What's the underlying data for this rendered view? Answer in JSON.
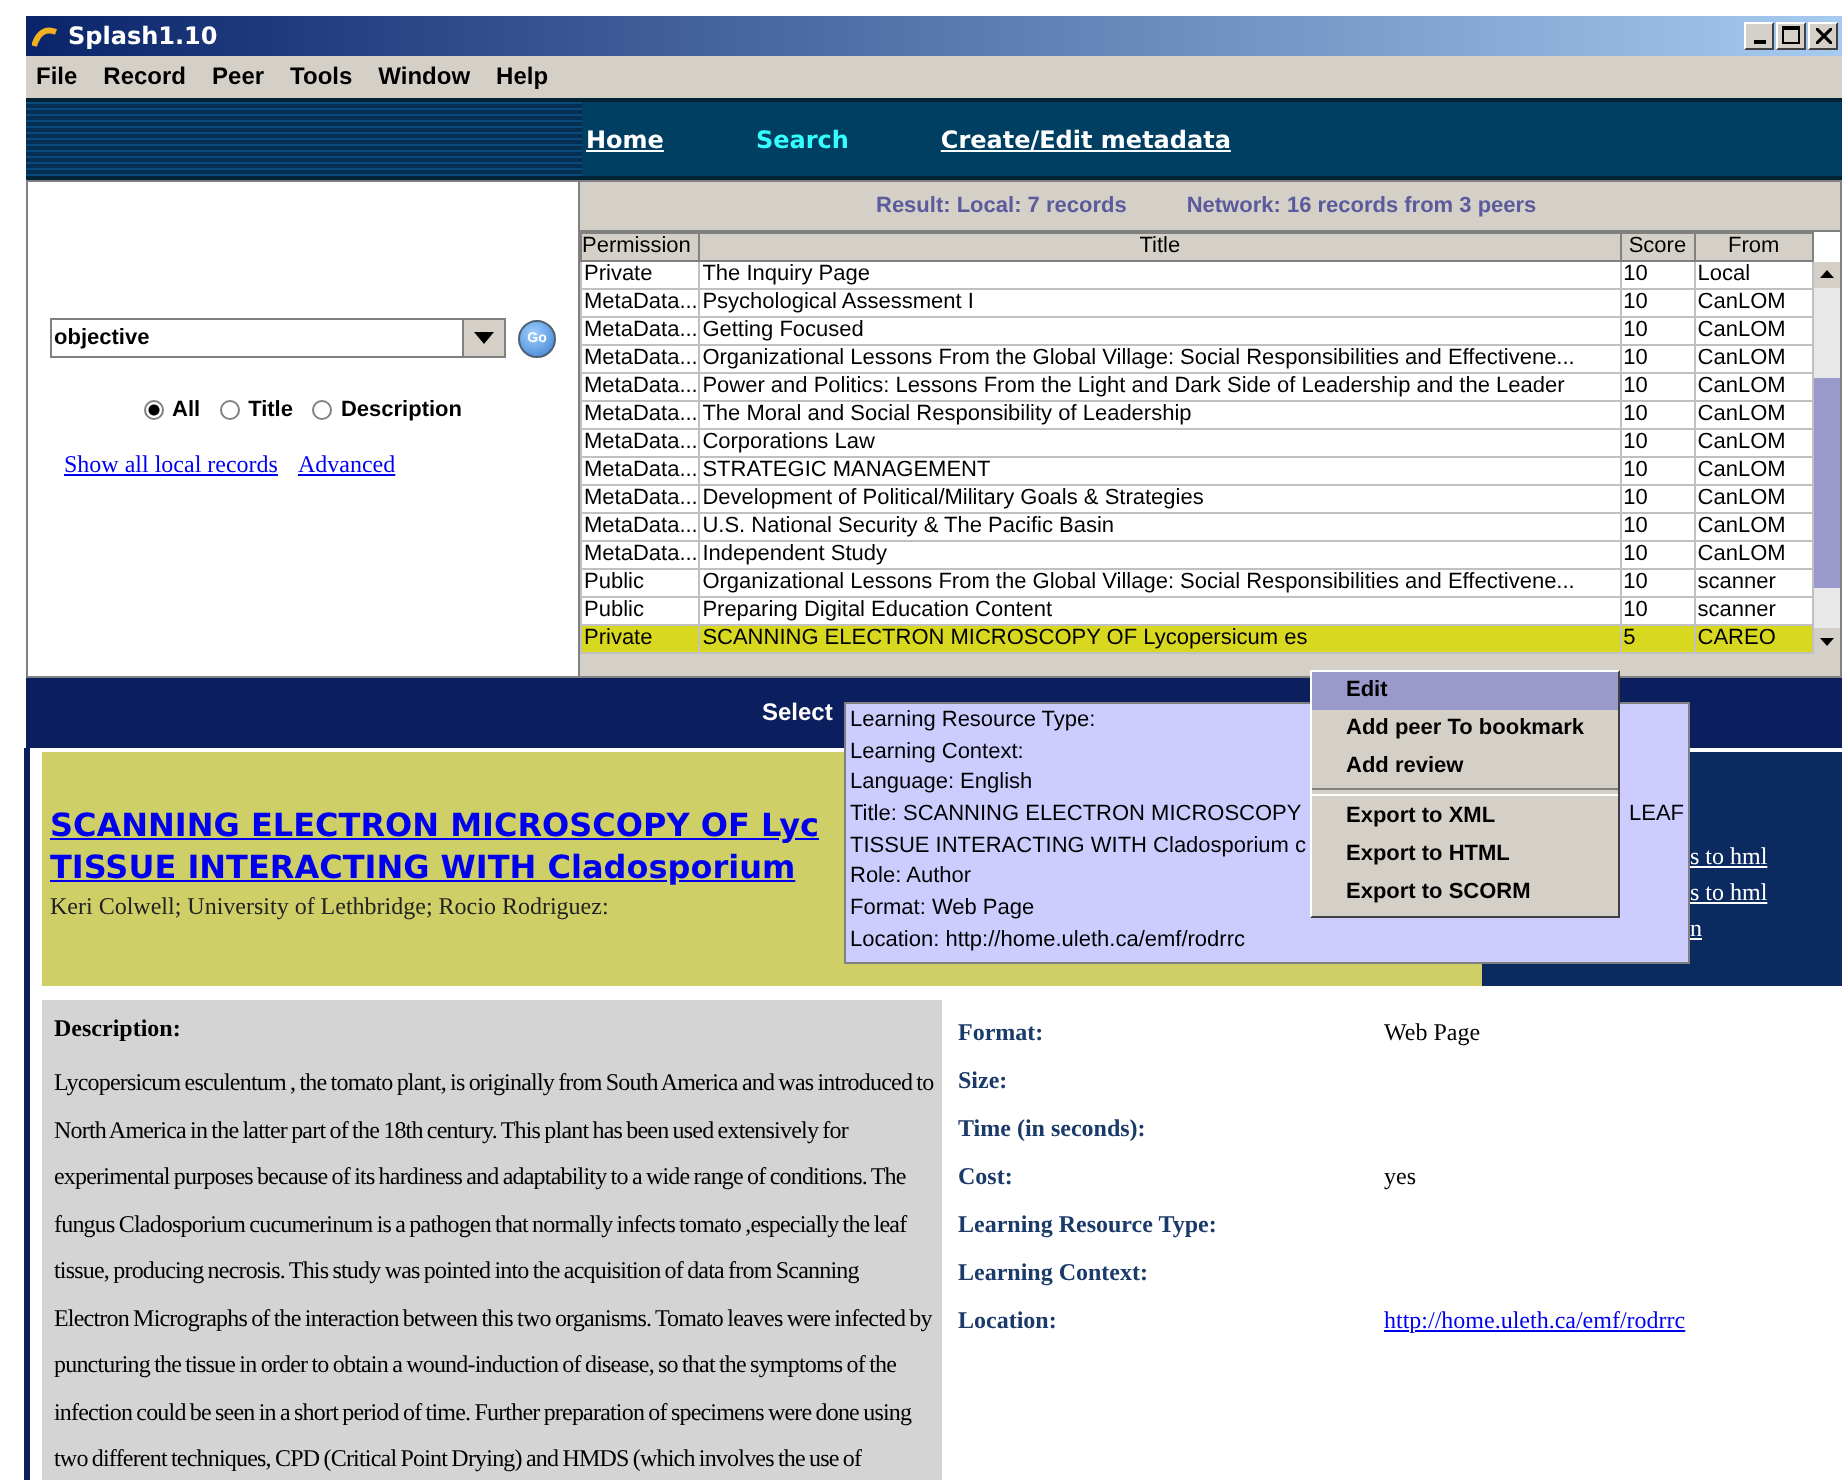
{
  "window": {
    "title": "Splash1.10"
  },
  "menu_bar": [
    "File",
    "Record",
    "Peer",
    "Tools",
    "Window",
    "Help"
  ],
  "nav": [
    {
      "label": "Home",
      "selected": false
    },
    {
      "label": "Search",
      "selected": true
    },
    {
      "label": "Create/Edit metadata",
      "selected": false
    }
  ],
  "search": {
    "value": "objective",
    "go_label": "Go",
    "scope": [
      {
        "label": "All",
        "selected": true
      },
      {
        "label": "Title",
        "selected": false
      },
      {
        "label": "Description",
        "selected": false
      }
    ],
    "links": [
      "Show all local records",
      "Advanced"
    ]
  },
  "results": {
    "summary": [
      "Result: Local: 7 records",
      "Network: 16 records from 3 peers"
    ],
    "columns": [
      "Permission",
      "Title",
      "Score",
      "From"
    ],
    "rows": [
      {
        "permission": "Private",
        "title": "The Inquiry Page",
        "score": "10",
        "from": "Local",
        "selected": false
      },
      {
        "permission": "MetaData...",
        "title": "Psychological Assessment I",
        "score": "10",
        "from": "CanLOM",
        "selected": false
      },
      {
        "permission": "MetaData...",
        "title": "Getting Focused",
        "score": "10",
        "from": "CanLOM",
        "selected": false
      },
      {
        "permission": "MetaData...",
        "title": "Organizational Lessons From the Global Village: Social Responsibilities and Effectivene...",
        "score": "10",
        "from": "CanLOM",
        "selected": false
      },
      {
        "permission": "MetaData...",
        "title": "Power and Politics: Lessons From the Light and Dark Side of Leadership and the Leader",
        "score": "10",
        "from": "CanLOM",
        "selected": false
      },
      {
        "permission": "MetaData...",
        "title": "The Moral and Social Responsibility of Leadership",
        "score": "10",
        "from": "CanLOM",
        "selected": false
      },
      {
        "permission": "MetaData...",
        "title": "Corporations Law",
        "score": "10",
        "from": "CanLOM",
        "selected": false
      },
      {
        "permission": "MetaData...",
        "title": "STRATEGIC MANAGEMENT",
        "score": "10",
        "from": "CanLOM",
        "selected": false
      },
      {
        "permission": "MetaData...",
        "title": "Development of Political/Military Goals & Strategies",
        "score": "10",
        "from": "CanLOM",
        "selected": false
      },
      {
        "permission": "MetaData...",
        "title": "U.S. National Security & The Pacific Basin",
        "score": "10",
        "from": "CanLOM",
        "selected": false
      },
      {
        "permission": "MetaData...",
        "title": "Independent Study",
        "score": "10",
        "from": "CanLOM",
        "selected": false
      },
      {
        "permission": "Public",
        "title": "Organizational Lessons From the Global Village: Social Responsibilities and Effectivene...",
        "score": "10",
        "from": "scanner",
        "selected": false
      },
      {
        "permission": "Public",
        "title": "Preparing Digital Education Content",
        "score": "10",
        "from": "scanner",
        "selected": false
      },
      {
        "permission": "Private",
        "title": "SCANNING ELECTRON MICROSCOPY OF Lycopersicum es",
        "score": "5",
        "from": "CAREO",
        "selected": true
      }
    ]
  },
  "select_bar": "Select",
  "record": {
    "title_lines": [
      "SCANNING ELECTRON MICROSCOPY OF Lyc",
      "TISSUE INTERACTING WITH Cladosporium"
    ],
    "authors": "Keri Colwell; University of Lethbridge; Rocio Rodriguez:",
    "side_links": [
      "s to hml",
      "s to hml",
      "n"
    ]
  },
  "description": {
    "heading": "Description:",
    "text": "Lycopersicum esculentum , the tomato plant, is originally from South America and was introduced to North America in the latter part of the 18th century. This plant has been used extensively for experimental purposes because of its hardiness and adaptability to a wide range of conditions. The fungus Cladosporium cucumerinum is a pathogen that normally infects tomato ,especially the leaf tissue, producing necrosis. This study was pointed into the acquisition of data from Scanning Electron Micrographs of the interaction between this two organisms. Tomato leaves were infected by puncturing the tissue in order to obtain a wound-induction of disease, so that the symptoms of the infection could be seen in a short period of time. Further preparation of specimens were done using two different techniques, CPD (Critical Point Drying) and HMDS (which involves the use of"
  },
  "fields": [
    {
      "label": "Format:",
      "value": "Web Page",
      "kind": "text"
    },
    {
      "label": "Size:"
    },
    {
      "label": "Time (in seconds):"
    },
    {
      "label": "Cost:",
      "value": "yes",
      "kind": "text"
    },
    {
      "label": "Learning Resource Type:"
    },
    {
      "label": "Learning Context:"
    },
    {
      "label": "Location:",
      "value": "http://home.uleth.ca/emf/rodrrc",
      "kind": "link"
    }
  ],
  "tooltip": {
    "lines": [
      {
        "text": "Learning Resource Type:"
      },
      {
        "text": "Learning Context:"
      },
      {
        "text": "Language: English"
      },
      {
        "text": "Title: SCANNING ELECTRON MICROSCOPY",
        "tail": "LEAF"
      },
      {
        "text": "TISSUE INTERACTING WITH Cladosporium c"
      },
      {
        "text": "Role: Author"
      },
      {
        "text": "Format: Web Page"
      },
      {
        "text": "Location: http://home.uleth.ca/emf/rodrrc"
      }
    ]
  },
  "context_menu": [
    {
      "kind": "item",
      "label": "Edit",
      "selected": true
    },
    {
      "kind": "item",
      "label": "Add peer To bookmark",
      "selected": false
    },
    {
      "kind": "item",
      "label": "Add review",
      "selected": false
    },
    {
      "kind": "separator"
    },
    {
      "kind": "item",
      "label": "Export to XML",
      "selected": false
    },
    {
      "kind": "item",
      "label": "Export to HTML",
      "selected": false
    },
    {
      "kind": "item",
      "label": "Export to SCORM",
      "selected": false
    }
  ]
}
